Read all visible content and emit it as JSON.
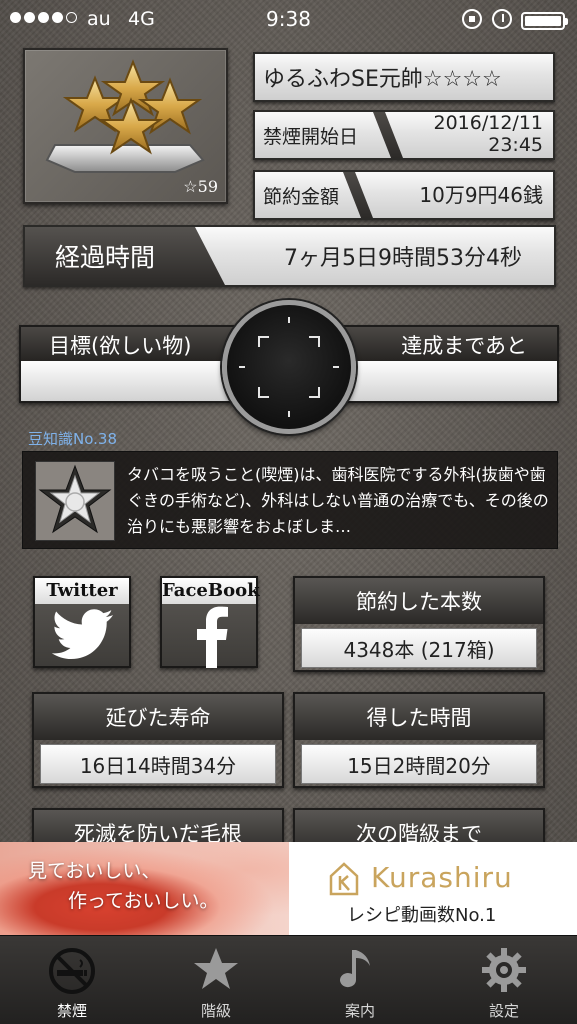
{
  "status_bar": {
    "carrier": "au",
    "network": "4G",
    "time": "9:38",
    "signal_bars": 4,
    "signal_max": 5
  },
  "rank": {
    "name": "ゆるふわSE元帥☆☆☆☆",
    "stars_label": "☆59"
  },
  "quit_start": {
    "label": "禁煙開始日",
    "date": "2016/12/11",
    "time": "23:45"
  },
  "savings": {
    "label": "節約金額",
    "value": "10万9円46銭"
  },
  "elapsed": {
    "label": "経過時間",
    "value": "7ヶ月5日9時間53分4秒"
  },
  "goal": {
    "left_label": "目標(欲しい物)",
    "right_label": "達成まであと",
    "value": ""
  },
  "trivia": {
    "title": "豆知識No.38",
    "text": "タバコを吸うこと(喫煙)は、歯科医院でする外科(抜歯や歯ぐきの手術など)、外科はしない普通の治療でも、その後の治りにも悪影響をおよぼしま…"
  },
  "social": {
    "twitter_label": "Twitter",
    "facebook_label": "FaceBook"
  },
  "stats": {
    "saved_cigs": {
      "label": "節約した本数",
      "value": "4348本 (217箱)"
    },
    "life_extended": {
      "label": "延びた寿命",
      "value": "16日14時間34分"
    },
    "time_gained": {
      "label": "得した時間",
      "value": "15日2時間20分"
    },
    "hair_saved": {
      "label": "死滅を防いだ毛根"
    },
    "next_rank": {
      "label": "次の階級まで"
    }
  },
  "ad": {
    "copy_line1": "見ておいしい、",
    "copy_line2": "作っておいしい。",
    "brand": "Kurashiru",
    "tagline": "レシピ動画数No.1",
    "brand_color": "#c9a45d"
  },
  "tabs": [
    {
      "label": "禁煙",
      "icon": "no-smoking-icon",
      "active": true
    },
    {
      "label": "階級",
      "icon": "star-icon",
      "active": false
    },
    {
      "label": "案内",
      "icon": "music-note-icon",
      "active": false
    },
    {
      "label": "設定",
      "icon": "gear-icon",
      "active": false
    }
  ]
}
